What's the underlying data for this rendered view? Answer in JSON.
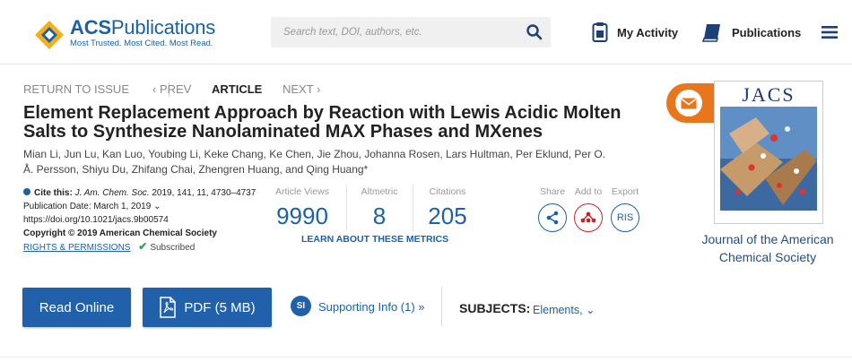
{
  "header": {
    "brand_main": "ACS",
    "brand_rest": "Publications",
    "tagline": "Most Trusted. Most Cited. Most Read.",
    "search_placeholder": "Search text, DOI, authors, etc.",
    "my_activity": "My Activity",
    "publications": "Publications"
  },
  "nav": {
    "return": "RETURN TO ISSUE",
    "prev": "‹ PREV",
    "article": "ARTICLE",
    "next": "NEXT ›"
  },
  "article": {
    "title": "Element Replacement Approach by Reaction with Lewis Acidic Molten Salts to Synthesize Nanolaminated MAX Phases and MXenes",
    "authors": "Mian Li, Jun Lu, Kan Luo, Youbing Li, Keke Chang, Ke Chen, Jie Zhou, Johanna Rosen, Lars Hultman, Per Eklund, Per O. Å. Persson, Shiyu Du, Zhifang Chai, Zhengren Huang, and Qing Huang*"
  },
  "cite": {
    "label": "Cite this:",
    "journal": "J. Am. Chem. Soc.",
    "ref": "2019, 141, 11, 4730–4737",
    "pub_date": "Publication Date: March 1, 2019",
    "date_chevron": "⌄",
    "doi": "https://doi.org/10.1021/jacs.9b00574",
    "copyright": "Copyright © 2019 American Chemical Society",
    "rights": "RIGHTS & PERMISSIONS",
    "check": "✔",
    "subscribed": "Subscribed"
  },
  "metrics": {
    "views_label": "Article Views",
    "views": "9990",
    "altmetric_label": "Altmetric",
    "altmetric": "8",
    "citations_label": "Citations",
    "citations": "205",
    "learn": "LEARN ABOUT THESE METRICS"
  },
  "actions": {
    "share": "Share",
    "add_to": "Add to",
    "export": "Export",
    "ris": "RIS"
  },
  "journal": {
    "cover_title": "JACS",
    "name": "Journal of the American Chemical Society"
  },
  "buttons": {
    "read_online": "Read Online",
    "pdf": "PDF (5 MB)",
    "si_badge": "SI",
    "supporting_info": "Supporting Info (1) »",
    "subjects_label": "SUBJECTS:",
    "subjects_value": "Elements, ⌄"
  },
  "colors": {
    "brand_blue": "#1a61a6",
    "button_blue": "#2161ab",
    "orange": "#e8761c",
    "addto_red": "#c0272d"
  }
}
